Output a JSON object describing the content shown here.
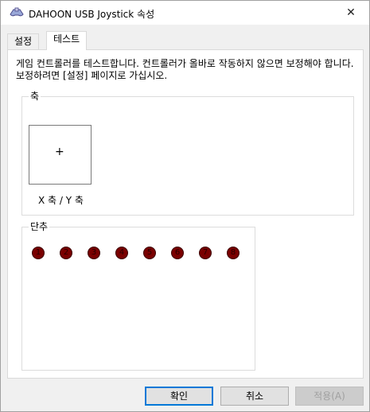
{
  "window": {
    "title": "DAHOON USB Joystick 속성",
    "icon": "joystick-icon",
    "close_glyph": "✕"
  },
  "tabs": [
    {
      "label": "설정",
      "active": false
    },
    {
      "label": "테스트",
      "active": true
    }
  ],
  "description": "게임 컨트롤러를 테스트합니다. 컨트롤러가 올바로 작동하지 않으면 보정해야 합니다. 보정하려면 [설정] 페이지로 가십시오.",
  "axes_group": {
    "label": "축",
    "crosshair": "+",
    "caption": "X 축 / Y 축"
  },
  "buttons_group": {
    "label": "단추",
    "buttons": [
      "1",
      "2",
      "3",
      "4",
      "5",
      "6",
      "7",
      "8"
    ]
  },
  "footer": {
    "ok_label": "확인",
    "cancel_label": "취소",
    "apply_label": "적용(A)"
  },
  "colors": {
    "accent": "#0078d7",
    "button_indicator": "#7a0000"
  }
}
